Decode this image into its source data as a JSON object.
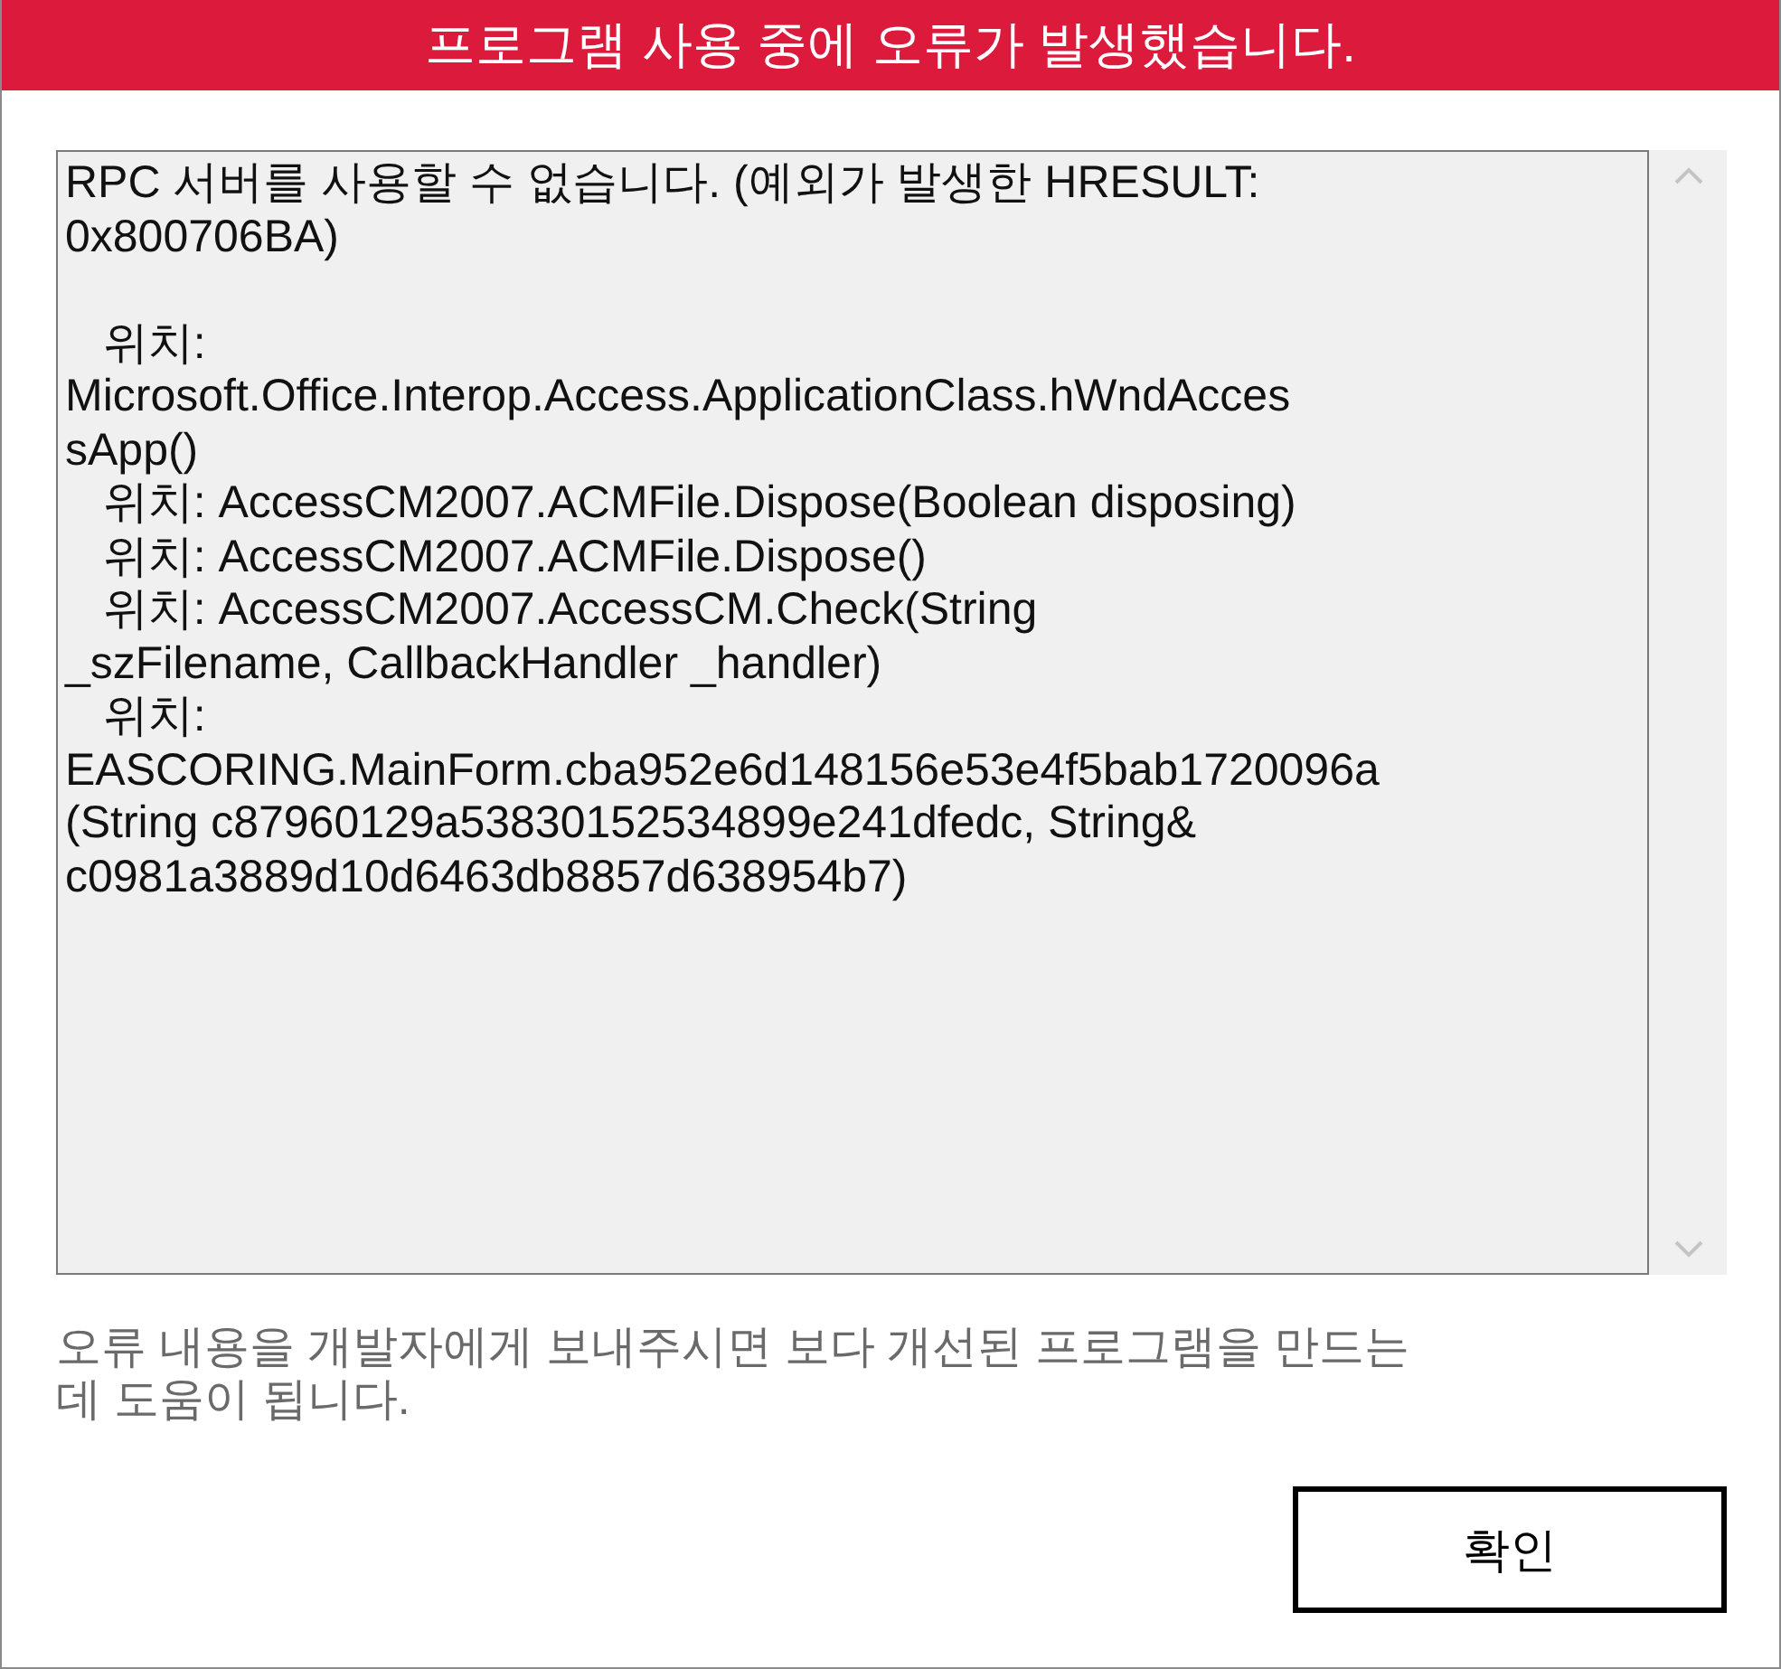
{
  "window": {
    "title": "프로그램 사용 중에 오류가 발생했습니다."
  },
  "error_details": {
    "text": "RPC 서버를 사용할 수 없습니다. (예외가 발생한 HRESULT:\n0x800706BA)\n\n   위치:\nMicrosoft.Office.Interop.Access.ApplicationClass.hWndAcces\nsApp()\n   위치: AccessCM2007.ACMFile.Dispose(Boolean disposing)\n   위치: AccessCM2007.ACMFile.Dispose()\n   위치: AccessCM2007.AccessCM.Check(String\n_szFilename, CallbackHandler _handler)\n   위치:\nEASCORING.MainForm.cba952e6d148156e53e4f5bab1720096a\n(String c87960129a53830152534899e241dfedc, String&\nc0981a3889d10d6463db8857d638954b7)"
  },
  "message": "오류 내용을 개발자에게 보내주시면 보다 개선된 프로그램을 만드는\n데 도움이 됩니다.",
  "buttons": [
    {
      "label": "확인"
    }
  ]
}
